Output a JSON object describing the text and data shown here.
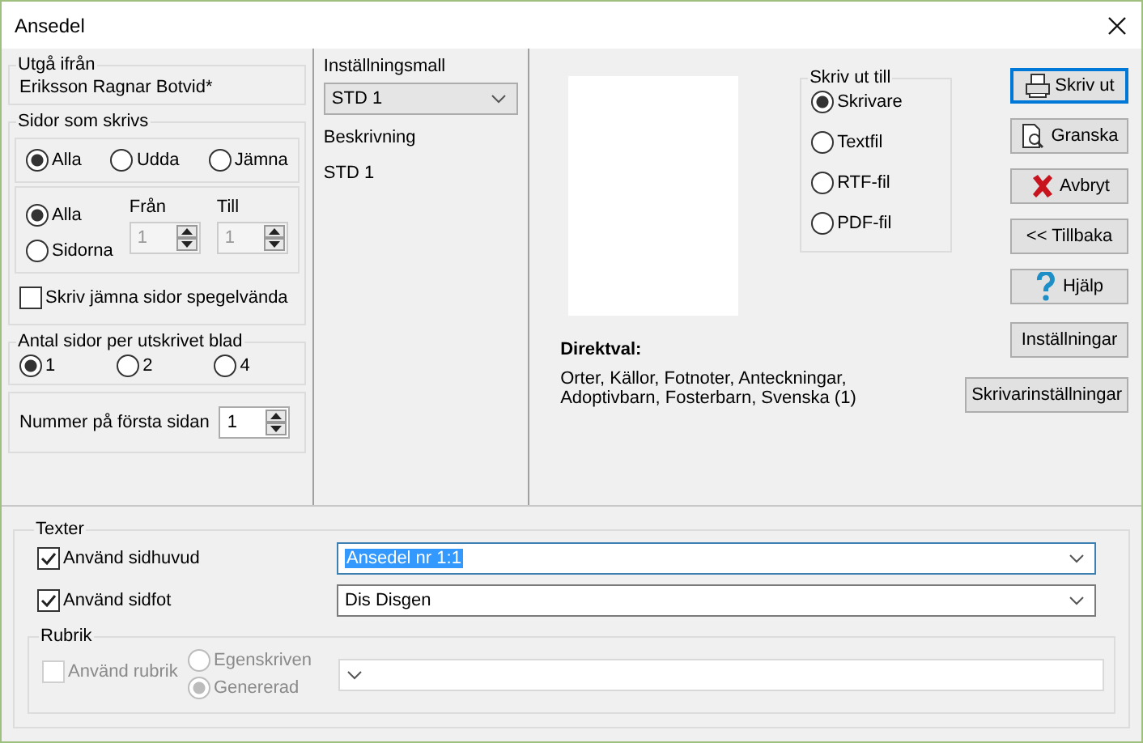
{
  "window": {
    "title": "Ansedel"
  },
  "start": {
    "label": "Utgå ifrån",
    "value": "Eriksson Ragnar Botvid*"
  },
  "pages": {
    "label": "Sidor som skrivs",
    "parity": [
      {
        "label": "Alla",
        "selected": true
      },
      {
        "label": "Udda",
        "selected": false
      },
      {
        "label": "Jämna",
        "selected": false
      }
    ],
    "range": [
      {
        "label": "Alla",
        "selected": true
      },
      {
        "label": "Sidorna",
        "selected": false
      }
    ],
    "from": {
      "label": "Från",
      "value": "1",
      "disabled": true
    },
    "to": {
      "label": "Till",
      "value": "1",
      "disabled": true
    },
    "mirror": {
      "label": "Skriv jämna sidor spegelvända",
      "checked": false
    }
  },
  "per_sheet": {
    "label": "Antal sidor per utskrivet blad",
    "options": [
      {
        "label": "1",
        "selected": true
      },
      {
        "label": "2",
        "selected": false
      },
      {
        "label": "4",
        "selected": false
      }
    ]
  },
  "first_page": {
    "label": "Nummer på första sidan",
    "value": "1"
  },
  "template": {
    "label": "Inställningsmall",
    "value": "STD 1"
  },
  "description": {
    "label": "Beskrivning",
    "value": "STD 1"
  },
  "output": {
    "label": "Skriv ut till",
    "options": [
      {
        "label": "Skrivare",
        "selected": true
      },
      {
        "label": "Textfil",
        "selected": false
      },
      {
        "label": "RTF-fil",
        "selected": false
      },
      {
        "label": "PDF-fil",
        "selected": false
      }
    ]
  },
  "direct": {
    "label": "Direktval:",
    "value": "Orter, Källor, Fotnoter, Anteckningar, Adoptivbarn, Fosterbarn, Svenska (1)"
  },
  "buttons": [
    {
      "label": "Skriv ut",
      "kind": "print",
      "default": true
    },
    {
      "label": "Granska",
      "kind": "preview",
      "default": false
    },
    {
      "label": "Avbryt",
      "kind": "cancel",
      "default": false
    },
    {
      "label": "<< Tillbaka",
      "kind": "plain",
      "default": false
    },
    {
      "label": "Hjälp",
      "kind": "help",
      "default": false
    },
    {
      "label": "Inställningar",
      "kind": "plain",
      "default": false
    },
    {
      "label": "Skrivarinställningar",
      "kind": "plain",
      "default": false
    }
  ],
  "texts": {
    "label": "Texter",
    "rows": [
      {
        "label": "Använd sidhuvud",
        "checked": true,
        "value": "Ansedel nr 1:1",
        "highlighted": true
      },
      {
        "label": "Använd sidfot",
        "checked": true,
        "value": "Dis Disgen",
        "highlighted": false
      }
    ]
  },
  "heading": {
    "label": "Rubrik",
    "disabled": true,
    "use": {
      "label": "Använd rubrik",
      "checked": false
    },
    "options": [
      {
        "label": "Egenskriven",
        "selected": false
      },
      {
        "label": "Genererad",
        "selected": true
      }
    ]
  }
}
